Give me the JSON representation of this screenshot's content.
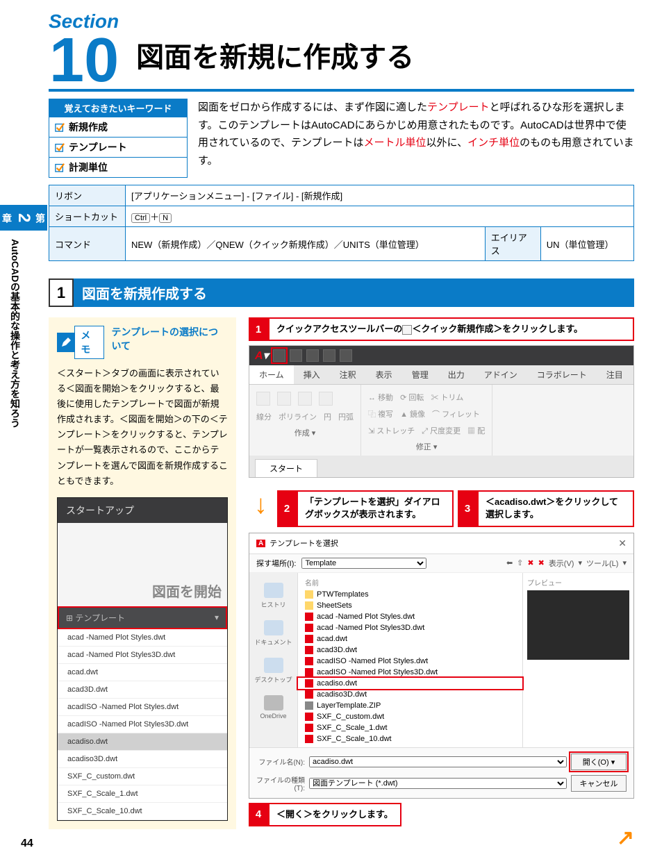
{
  "section": {
    "label": "Section",
    "number": "10",
    "title": "図面を新規に作成する"
  },
  "keywords": {
    "header": "覚えておきたいキーワード",
    "items": [
      "新規作成",
      "テンプレート",
      "計測単位"
    ]
  },
  "intro": {
    "before_red1": "図面をゼロから作成するには、まず作図に適した",
    "red1": "テンプレート",
    "mid1": "と呼ばれるひな形を選択します。このテンプレートはAutoCADにあらかじめ用意されたものです。AutoCADは世界中で使用されているので、テンプレートは",
    "red2": "メートル単位",
    "mid2": "以外に、",
    "red3": "インチ単位",
    "after": "のものも用意されています。"
  },
  "info_table": {
    "ribbon_label": "リボン",
    "ribbon_val": "[アプリケーションメニュー] - [ファイル] - [新規作成]",
    "shortcut_label": "ショートカット",
    "shortcut_k1": "Ctrl",
    "shortcut_plus": "＋",
    "shortcut_k2": "N",
    "command_label": "コマンド",
    "command_val": "NEW（新規作成）／QNEW（クイック新規作成）／UNITS（単位管理）",
    "alias_label": "エイリアス",
    "alias_val": "UN（単位管理）"
  },
  "side_tab": {
    "chapter_prefix": "第",
    "chapter_num": "2",
    "chapter_suffix": "章",
    "text": "AutoCADの基本的な操作と考え方を知ろう"
  },
  "sub_heading": {
    "num": "1",
    "title": "図面を新規作成する"
  },
  "memo": {
    "label": "メモ",
    "title": "テンプレートの選択について",
    "body": "＜スタート＞タブの画面に表示されている＜図面を開始＞をクリックすると、最後に使用したテンプレートで図面が新規作成されます。＜図面を開始＞の下の＜テンプレート＞をクリックすると、テンプレートが一覧表示されるので、ここからテンプレートを選んで図面を新規作成することもできます。"
  },
  "startup": {
    "title": "スタートアップ",
    "illust_text": "図面を開始",
    "template_label": "テンプレート",
    "files": [
      "acad -Named Plot Styles.dwt",
      "acad -Named Plot Styles3D.dwt",
      "acad.dwt",
      "acad3D.dwt",
      "acadISO -Named Plot Styles.dwt",
      "acadISO -Named Plot Styles3D.dwt",
      "acadiso.dwt",
      "acadiso3D.dwt",
      "SXF_C_custom.dwt",
      "SXF_C_Scale_1.dwt",
      "SXF_C_Scale_10.dwt"
    ]
  },
  "steps": {
    "s1": {
      "num": "1",
      "text_before": "クイックアクセスツールバーの",
      "text_after": "＜クイック新規作成＞をクリックします。"
    },
    "s2": {
      "num": "2",
      "text": "「テンプレートを選択」ダイアログボックスが表示されます。"
    },
    "s3": {
      "num": "3",
      "text": "＜acadiso.dwt＞をクリックして選択します。"
    },
    "s4": {
      "num": "4",
      "text": "＜開く＞をクリックします。"
    }
  },
  "ribbon": {
    "tabs": [
      "ホーム",
      "挿入",
      "注釈",
      "表示",
      "管理",
      "出力",
      "アドイン",
      "コラボレート",
      "注目"
    ],
    "panel1_tools": [
      "線分",
      "ポリライン",
      "円",
      "円弧"
    ],
    "panel1_label": "作成 ▾",
    "panel2_tools": [
      [
        "移動",
        "回転",
        "トリム"
      ],
      [
        "複写",
        "鏡像",
        "フィレット"
      ],
      [
        "ストレッチ",
        "尺度変更",
        "配"
      ]
    ],
    "panel2_label": "修正 ▾",
    "doctab": "スタート"
  },
  "dialog": {
    "title": "テンプレートを選択",
    "lookin_label": "探す場所(I):",
    "lookin_val": "Template",
    "view_btn": "表示(V)",
    "tool_btn": "ツール(L)",
    "name_header": "名前",
    "preview_label": "プレビュー",
    "sidebar": [
      "ヒストリ",
      "ドキュメント",
      "デスクトップ",
      "OneDrive"
    ],
    "files": [
      {
        "name": "PTWTemplates",
        "type": "folder"
      },
      {
        "name": "SheetSets",
        "type": "folder"
      },
      {
        "name": "acad -Named Plot Styles.dwt",
        "type": "dwt"
      },
      {
        "name": "acad -Named Plot Styles3D.dwt",
        "type": "dwt"
      },
      {
        "name": "acad.dwt",
        "type": "dwt"
      },
      {
        "name": "acad3D.dwt",
        "type": "dwt"
      },
      {
        "name": "acadISO -Named Plot Styles.dwt",
        "type": "dwt"
      },
      {
        "name": "acadISO -Named Plot Styles3D.dwt",
        "type": "dwt"
      },
      {
        "name": "acadiso.dwt",
        "type": "dwt",
        "highlighted": true
      },
      {
        "name": "acadiso3D.dwt",
        "type": "dwt"
      },
      {
        "name": "LayerTemplate.ZIP",
        "type": "zip"
      },
      {
        "name": "SXF_C_custom.dwt",
        "type": "dwt"
      },
      {
        "name": "SXF_C_Scale_1.dwt",
        "type": "dwt"
      },
      {
        "name": "SXF_C_Scale_10.dwt",
        "type": "dwt"
      }
    ],
    "filename_label": "ファイル名(N):",
    "filename_val": "acadiso.dwt",
    "filetype_label": "ファイルの種類(T):",
    "filetype_val": "図面テンプレート (*.dwt)",
    "open_btn": "開く(O)",
    "cancel_btn": "キャンセル"
  },
  "page_number": "44"
}
